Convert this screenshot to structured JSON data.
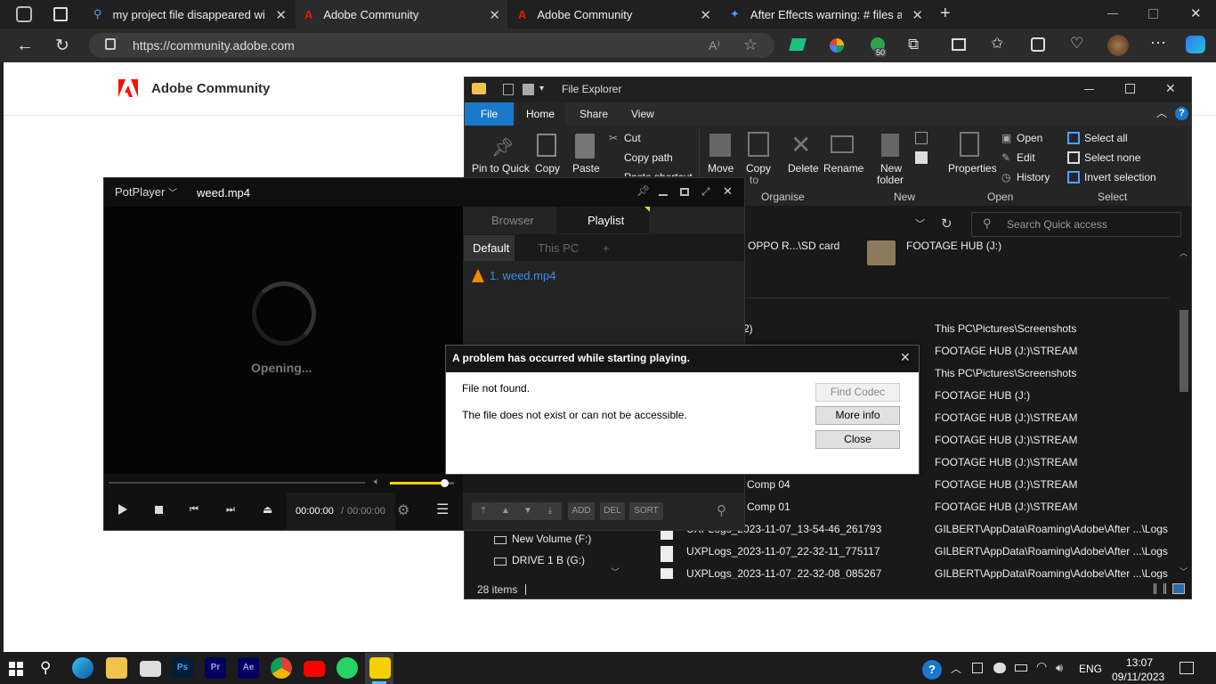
{
  "browser": {
    "tabs": [
      {
        "title": "my project file disappeared with",
        "icon": "search-icon"
      },
      {
        "title": "Adobe Community",
        "icon": "adobe-icon"
      },
      {
        "title": "Adobe Community",
        "icon": "adobe-icon"
      },
      {
        "title": "After Effects warning: # files are r",
        "icon": "copilot-icon"
      }
    ],
    "url": "https://community.adobe.com",
    "badge": "50"
  },
  "site": {
    "name": "Adobe Community"
  },
  "potplayer": {
    "menu": "PotPlayer",
    "file": "weed.mp4",
    "status": "Opening...",
    "tabs": [
      "Browser",
      "Playlist"
    ],
    "subtabs": [
      "Default",
      "This PC",
      "+"
    ],
    "playlist": [
      "1. weed.mp4"
    ],
    "time_current": "00:00:00",
    "time_sep": "/",
    "time_total": "00:00:00",
    "volume": 0.85,
    "buttons": [
      "ADD",
      "DEL",
      "SORT"
    ]
  },
  "explorer": {
    "title": "File Explorer",
    "tabs": [
      "File",
      "Home",
      "Share",
      "View"
    ],
    "ribbon": {
      "pin": "Pin to Quick",
      "copy": "Copy",
      "paste": "Paste",
      "cut": "Cut",
      "copy_path": "Copy path",
      "paste_shortcut": "Paste shortcut",
      "move": "Move",
      "copy_to": "Copy",
      "to": "to",
      "delete": "Delete",
      "rename": "Rename",
      "new_folder_1": "New",
      "new_folder_2": "folder",
      "properties": "Properties",
      "open": "Open",
      "edit": "Edit",
      "history": "History",
      "select_all": "Select all",
      "select_none": "Select none",
      "invert": "Invert selection",
      "groups": [
        "Organise",
        "New",
        "Open",
        "Select"
      ]
    },
    "search_placeholder": "Search Quick access",
    "top_items": [
      "OPPO R...\\SD card",
      "FOOTAGE HUB (J:)"
    ],
    "nav_items": [
      "New Volume (F:)",
      "DRIVE 1 B (G:)"
    ],
    "row_prefix_2": "2)",
    "rows": [
      {
        "name": "",
        "loc": "This PC\\Pictures\\Screenshots"
      },
      {
        "name": "",
        "loc": "FOOTAGE HUB (J:)\\STREAM"
      },
      {
        "name": "",
        "loc": "This PC\\Pictures\\Screenshots"
      },
      {
        "name": "",
        "loc": "FOOTAGE HUB (J:)"
      },
      {
        "name": "",
        "loc": "FOOTAGE HUB (J:)\\STREAM"
      },
      {
        "name": "",
        "loc": "FOOTAGE HUB (J:)\\STREAM"
      },
      {
        "name": "",
        "loc": "FOOTAGE HUB (J:)\\STREAM"
      },
      {
        "name": "Comp 04",
        "loc": "FOOTAGE HUB (J:)\\STREAM"
      },
      {
        "name": "Comp 01",
        "loc": "FOOTAGE HUB (J:)\\STREAM"
      },
      {
        "name": "UXPLogs_2023-11-07_13-54-46_261793",
        "loc": "GILBERT\\AppData\\Roaming\\Adobe\\After ...\\Logs"
      },
      {
        "name": "UXPLogs_2023-11-07_22-32-11_775117",
        "loc": "GILBERT\\AppData\\Roaming\\Adobe\\After ...\\Logs"
      },
      {
        "name": "UXPLogs_2023-11-07_22-32-08_085267",
        "loc": "GILBERT\\AppData\\Roaming\\Adobe\\After ...\\Logs"
      }
    ],
    "status": "28 items"
  },
  "dialog": {
    "title": "A problem has occurred while starting playing.",
    "line1": "File not found.",
    "line2": "The file does not exist or can not be accessible.",
    "btn_codec": "Find Codec",
    "btn_more": "More info",
    "btn_close": "Close"
  },
  "taskbar": {
    "lang": "ENG",
    "time": "13:07",
    "date": "09/11/2023"
  }
}
